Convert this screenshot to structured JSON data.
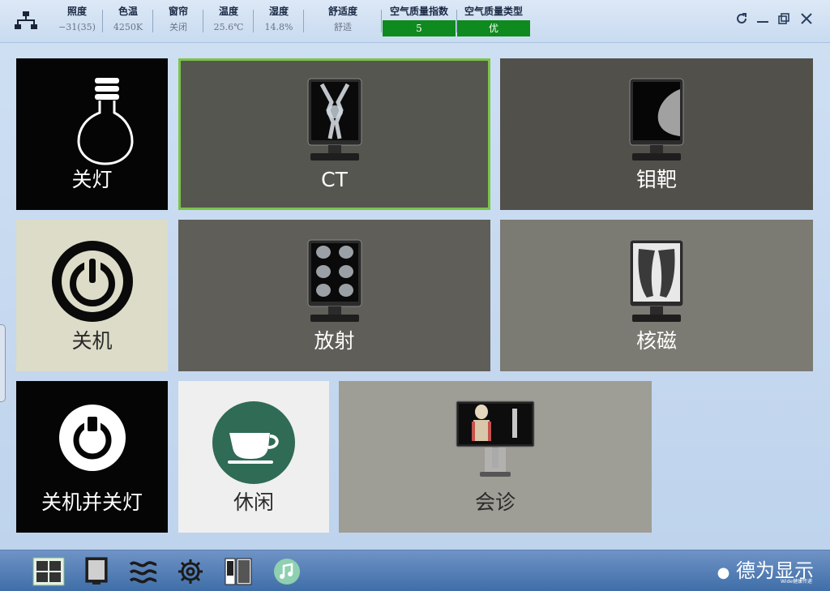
{
  "status": {
    "illuminance": {
      "label": "照度",
      "value": "−31(35)"
    },
    "color_temp": {
      "label": "色温",
      "value": "4250K"
    },
    "curtain": {
      "label": "窗帘",
      "value": "关闭"
    },
    "temperature": {
      "label": "温度",
      "value": "25.6℃"
    },
    "humidity": {
      "label": "湿度",
      "value": "14.8%"
    },
    "comfort": {
      "label": "舒适度",
      "value": "舒适"
    },
    "aqi": {
      "label": "空气质量指数",
      "value": "5"
    },
    "aq_type": {
      "label": "空气质量类型",
      "value": "优"
    },
    "aq_color": "#0f8a1e"
  },
  "window_controls": {
    "refresh_icon": "refresh-icon",
    "minimize_icon": "minimize-icon",
    "restore_icon": "restore-icon",
    "close_icon": "close-icon"
  },
  "tiles": {
    "lights_off": "关灯",
    "ct": "CT",
    "mammo": "钼靶",
    "shutdown": "关机",
    "radiology": "放射",
    "mri": "核磁",
    "shutdown_lights": "关机并关灯",
    "leisure": "休闲",
    "consult": "会诊"
  },
  "colors": {
    "selected_border": "#7cc34a",
    "aq_green": "#0f8a1e"
  },
  "bottom_icons": [
    "xray-grid-icon",
    "chest-xray-icon",
    "waves-icon",
    "gear-icon",
    "monitor-speaker-icon",
    "music-icon"
  ],
  "brand": {
    "text": "德为显示",
    "subtext": "Wide健康传递"
  }
}
